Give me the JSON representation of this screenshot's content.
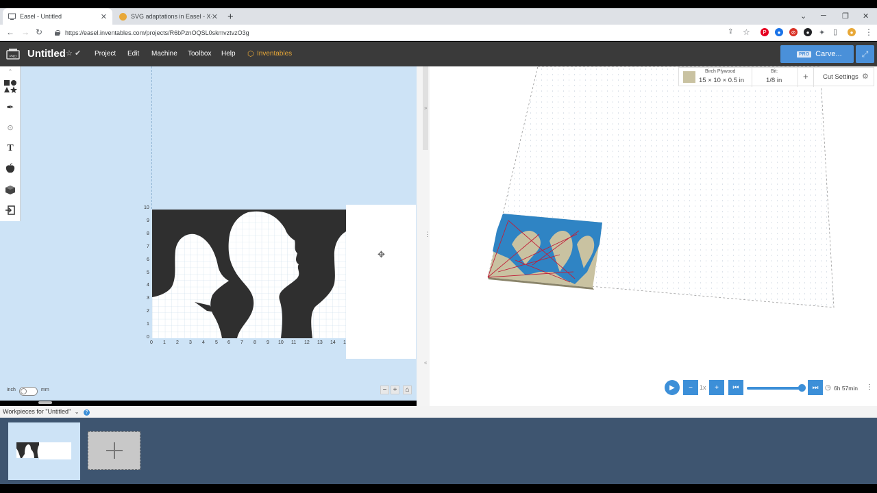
{
  "browser": {
    "tabs": [
      {
        "title": "Easel - Untitled",
        "active": true
      },
      {
        "title": "SVG adaptations in Easel - X-Car",
        "active": false
      }
    ],
    "url": "https://easel.inventables.com/projects/R6bPznOQSL0skmvztvzO3g"
  },
  "app": {
    "title": "Untitled",
    "menu": [
      "Project",
      "Edit",
      "Machine",
      "Toolbox",
      "Help",
      "Inventables"
    ],
    "carve_label": "Carve...",
    "pro_badge": "PRO"
  },
  "canvas": {
    "y_ticks": [
      "10",
      "9",
      "8",
      "7",
      "6",
      "5",
      "4",
      "3",
      "2",
      "1",
      "0"
    ],
    "x_ticks": [
      "0",
      "1",
      "2",
      "3",
      "4",
      "5",
      "6",
      "7",
      "8",
      "9",
      "10",
      "11",
      "12",
      "13",
      "14",
      "1"
    ],
    "unit_left": "inch",
    "unit_right": "mm"
  },
  "material": {
    "name": "Birch Plywood",
    "size": "15 × 10 × 0.5 in",
    "bit_label": "Bit:",
    "bit_value": "1/8 in",
    "cut_settings": "Cut Settings"
  },
  "player": {
    "speed": "1x",
    "time": "6h 57min"
  },
  "workpieces": {
    "label": "Workpieces for \"Untitled\""
  },
  "colors": {
    "accent": "#3c8fd8",
    "header": "#3a3a3a",
    "canvas_bg": "#cde3f6",
    "workpiece_bar": "#3e5570",
    "material": "#c9c2a1"
  }
}
